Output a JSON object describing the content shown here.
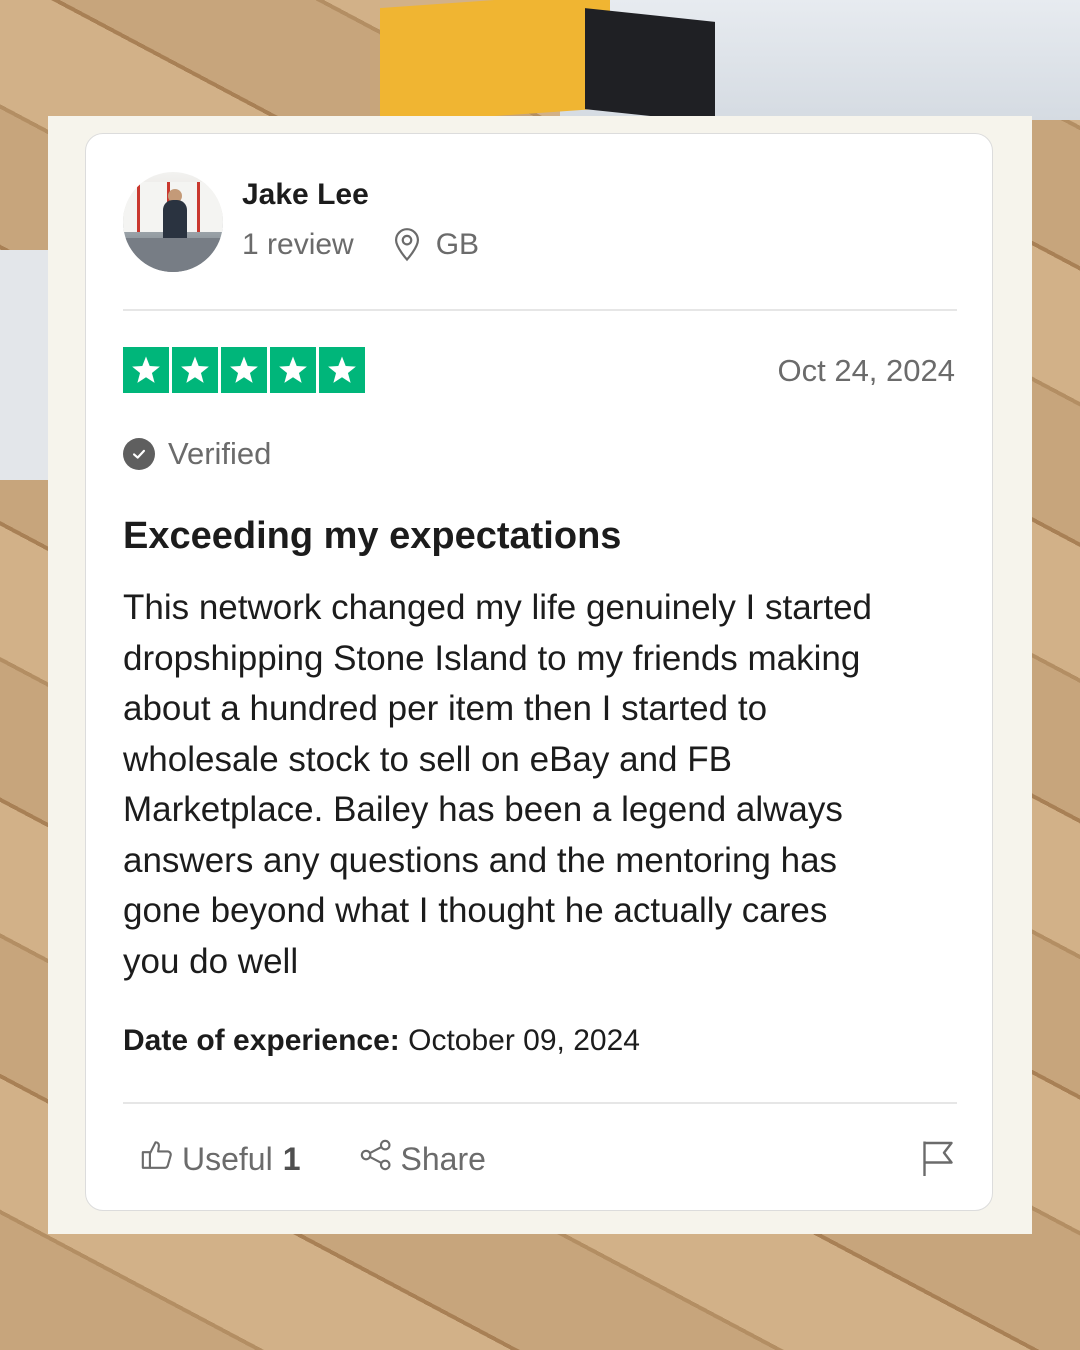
{
  "reviewer": {
    "name": "Jake Lee",
    "review_count": "1 review",
    "country": "GB",
    "avatar_icon": "avatar-photo"
  },
  "rating": {
    "stars": 5,
    "max_stars": 5,
    "color": "#00b67a"
  },
  "review": {
    "date": "Oct 24, 2024",
    "verified_label": "Verified",
    "title": "Exceeding my expectations",
    "body": "This network changed my life genuinely I started\ndropshipping Stone Island to my friends making\nabout a hundred per item then I started to\nwholesale stock to sell on eBay and FB\nMarketplace. Bailey has been a legend always\nanswers any questions and the mentoring has\ngone beyond what I thought he actually cares\nyou do well",
    "experience_label": "Date of experience:",
    "experience_date": "October 09, 2024"
  },
  "actions": {
    "useful_label": "Useful",
    "useful_count": "1",
    "share_label": "Share",
    "useful_icon": "thumbs-up-icon",
    "share_icon": "share-icon",
    "report_icon": "flag-icon"
  }
}
